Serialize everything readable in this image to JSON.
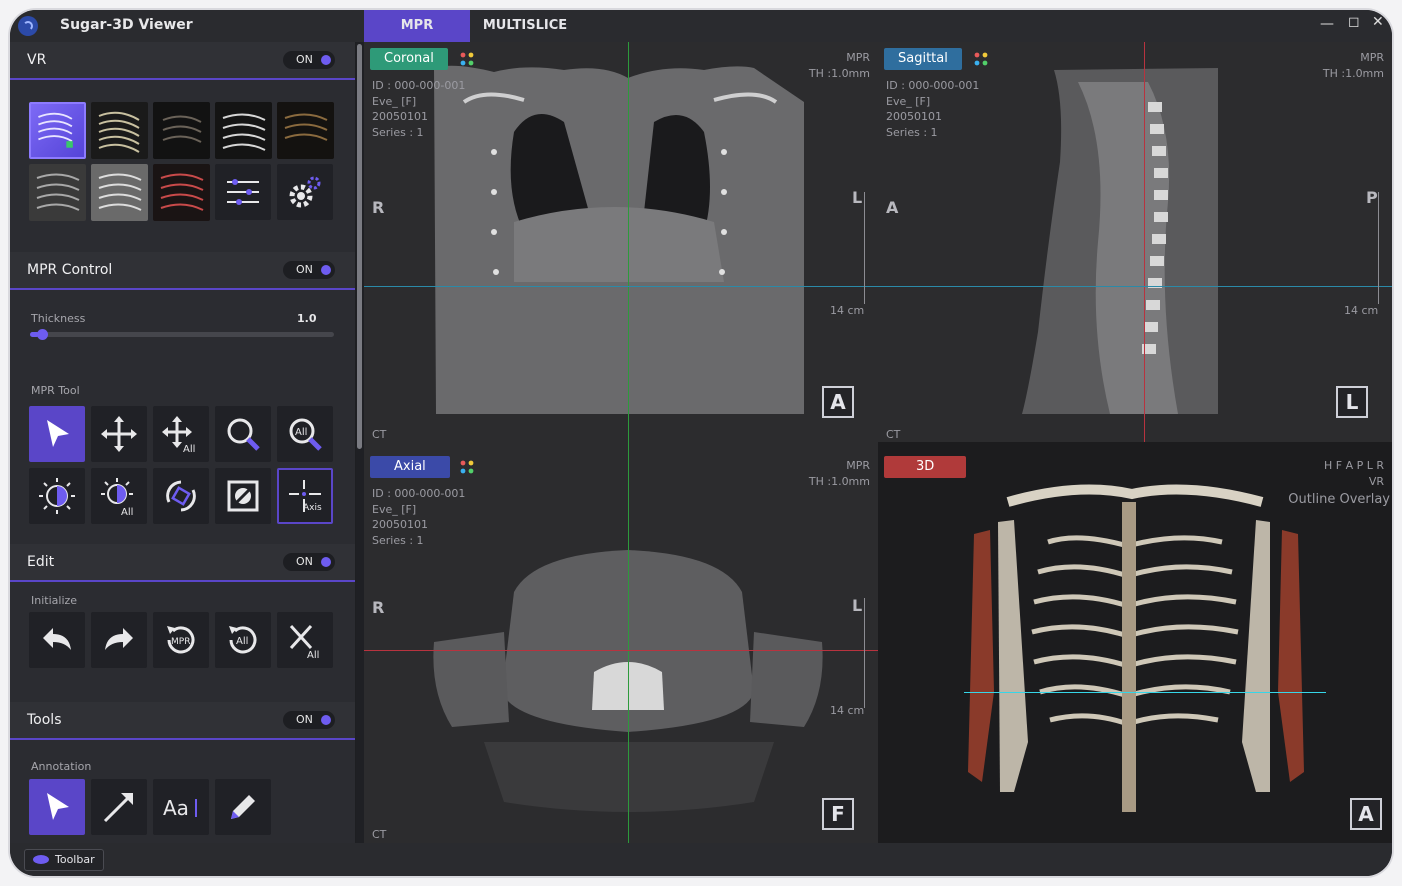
{
  "app": {
    "title": "Sugar-3D Viewer"
  },
  "tabs": [
    {
      "label": "MPR"
    },
    {
      "label": "MULTISLICE"
    }
  ],
  "sidebar": {
    "vr": {
      "title": "VR",
      "toggle": "ON"
    },
    "mpr_control": {
      "title": "MPR Control",
      "toggle": "ON",
      "thickness_label": "Thickness",
      "thickness_value": "1.0",
      "thickness_fraction": 0.03
    },
    "mpr_tool": {
      "title": "MPR Tool"
    },
    "edit": {
      "title": "Edit",
      "toggle": "ON",
      "initialize_label": "Initialize"
    },
    "tools": {
      "title": "Tools",
      "toggle": "ON",
      "annotation_label": "Annotation"
    },
    "icon_texts": {
      "all": "All",
      "axis": "Axis",
      "mpr": "MPR",
      "aa": "Aa"
    }
  },
  "viewports": {
    "coronal": {
      "label": "Coronal",
      "color": "#2e9a78",
      "info": [
        "ID : 000-000-001",
        "Eve_ [F]",
        "20050101",
        "Series : 1"
      ],
      "mpr": [
        "MPR",
        "TH :1.0mm"
      ],
      "orient_left": "R",
      "orient_right": "L",
      "scale": "14 cm",
      "modality": "CT",
      "dir": "A"
    },
    "sagittal": {
      "label": "Sagittal",
      "color": "#2f6e9e",
      "info": [
        "ID : 000-000-001",
        "Eve_ [F]",
        "20050101",
        "Series : 1"
      ],
      "mpr": [
        "MPR",
        "TH :1.0mm"
      ],
      "orient_left": "A",
      "orient_right": "P",
      "scale": "14 cm",
      "modality": "CT",
      "dir": "L"
    },
    "axial": {
      "label": "Axial",
      "color": "#3b4aa8",
      "info": [
        "ID : 000-000-001",
        "Eve_ [F]",
        "20050101",
        "Series : 1"
      ],
      "mpr": [
        "MPR",
        "TH :1.0mm"
      ],
      "orient_left": "R",
      "orient_right": "L",
      "scale": "14 cm",
      "modality": "CT",
      "dir": "F"
    },
    "vr3d": {
      "label": "3D",
      "color": "#b03a3a",
      "info": [
        "H F A P L R",
        "VR",
        "Outline Overlay"
      ],
      "dir": "A"
    }
  },
  "footer": {
    "toolbar_label": "Toolbar"
  }
}
